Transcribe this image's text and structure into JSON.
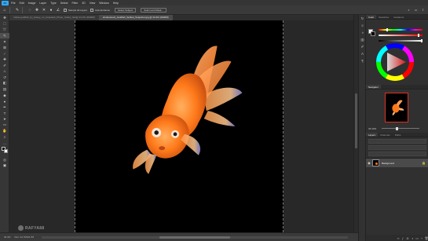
{
  "app": {
    "logo": "Ps"
  },
  "menubar": {
    "items": [
      {
        "label": "File"
      },
      {
        "label": "Edit"
      },
      {
        "label": "Image"
      },
      {
        "label": "Layer"
      },
      {
        "label": "Type"
      },
      {
        "label": "Select"
      },
      {
        "label": "Filter"
      },
      {
        "label": "3D"
      },
      {
        "label": "View"
      },
      {
        "label": "Window"
      },
      {
        "label": "Help"
      }
    ]
  },
  "options": {
    "sample_all_layers": "Sample All Layers",
    "auto_enhance": "Auto-Enhance",
    "select_subject": "Select Subject",
    "select_mask": "Select and Mask..."
  },
  "tabs": [
    {
      "label": "Yellow goldfish_by_Kassy_on_Unsplash_Photo_Yellow_fish@ 33.3% (RGB/8)",
      "active": false
    },
    {
      "label": "shutterstock_Goldfish_Spilled_Snapshot.jpg @ 33.3% (RGB/8)",
      "active": true
    }
  ],
  "status": {
    "zoom": "33.3%",
    "doc_info": "Doc: 24.7M/24.7M"
  },
  "watermark": {
    "text": "RAFYA88"
  },
  "panels": {
    "color_tabs": [
      {
        "label": "Color",
        "active": true
      },
      {
        "label": "Swatches",
        "active": false
      },
      {
        "label": "Gradients",
        "active": false
      }
    ],
    "navigator_tabs": [
      {
        "label": "Navigator",
        "active": true
      }
    ],
    "navigator_zoom": "33.33%",
    "layers_tabs": [
      {
        "label": "Layers",
        "active": true
      },
      {
        "label": "Channels",
        "active": false
      },
      {
        "label": "Paths",
        "active": false
      }
    ],
    "layer_name": "Background",
    "layer_lock": "🔒"
  },
  "colors": {
    "accent": "#31a8ff",
    "fish_orange": "#ff7a1a",
    "nav_frame": "#e03020"
  },
  "icons": {
    "tools": [
      "move-icon",
      "marquee-icon",
      "lasso-icon",
      "quick-select-icon",
      "crop-icon",
      "frame-icon",
      "eyedropper-icon",
      "healing-icon",
      "brush-icon",
      "stamp-icon",
      "history-brush-icon",
      "eraser-icon",
      "gradient-icon",
      "blur-icon",
      "dodge-icon",
      "pen-icon",
      "type-icon",
      "path-select-icon",
      "rectangle-icon",
      "hand-icon",
      "zoom-icon",
      "more-icon"
    ]
  }
}
